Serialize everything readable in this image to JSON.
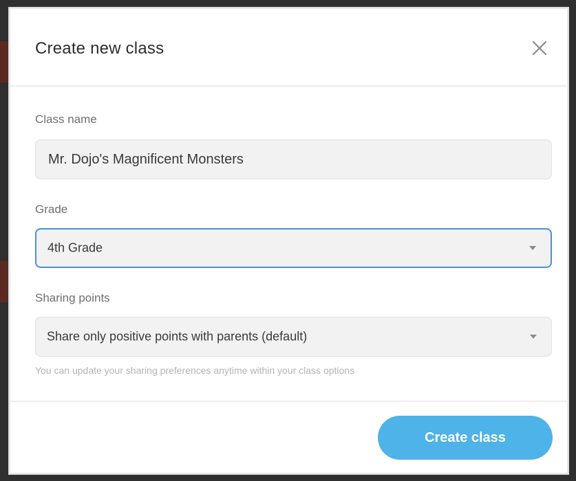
{
  "modal": {
    "title": "Create new class",
    "close_icon": "close-icon"
  },
  "form": {
    "class_name": {
      "label": "Class name",
      "value": "Mr. Dojo's Magnificent Monsters"
    },
    "grade": {
      "label": "Grade",
      "selected": "4th Grade"
    },
    "sharing_points": {
      "label": "Sharing points",
      "selected": "Share only positive points with parents (default)",
      "hint": "You can update your sharing preferences anytime within your class options"
    }
  },
  "footer": {
    "submit_label": "Create class"
  },
  "colors": {
    "primary": "#4db3e8",
    "focus_border": "#4a90d9",
    "input_bg": "#f2f2f2"
  }
}
